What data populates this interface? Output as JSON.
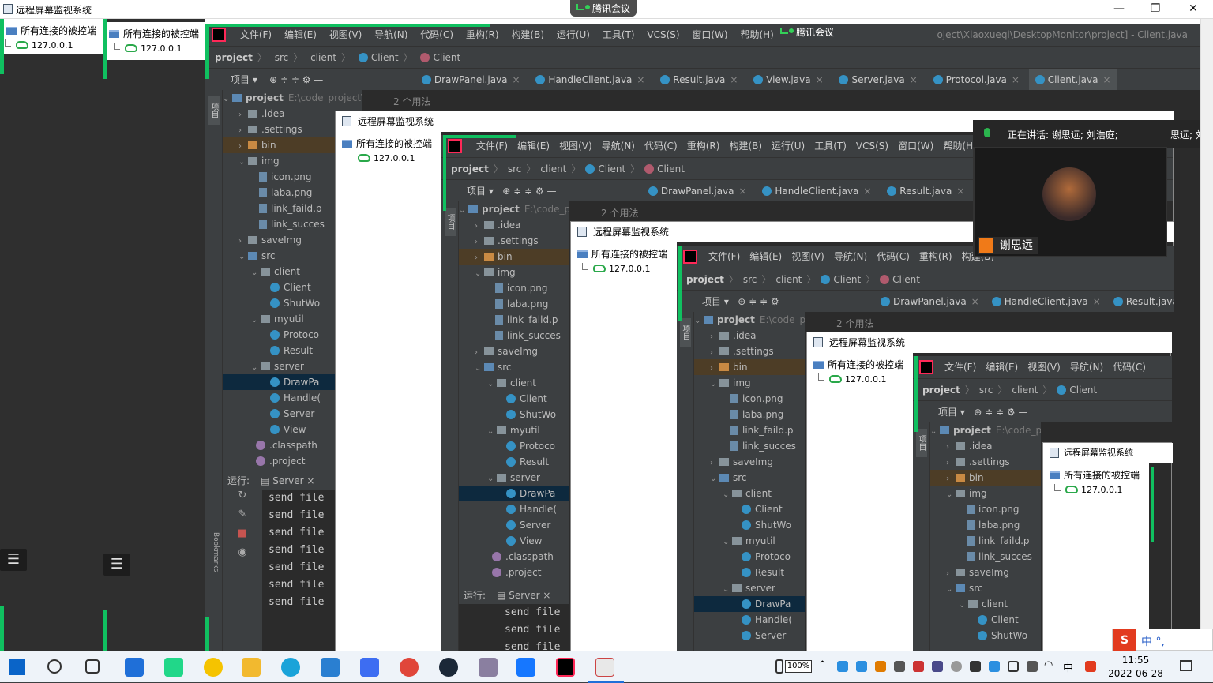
{
  "window": {
    "title": "远程屏幕监视系统",
    "minimize_label": "—",
    "maximize_label": "❐",
    "close_label": "✕"
  },
  "meeting": {
    "pill_label": "腾讯会议",
    "speaking_text": "正在讲话: 谢思远; 刘浩庭;",
    "speaking_trunc": "思远; 刘",
    "participant_name": "谢思远"
  },
  "tree": {
    "root_label": "所有连接的被控端",
    "child_label": "127.0.0.1"
  },
  "ide": {
    "menu": [
      "文件(F)",
      "编辑(E)",
      "视图(V)",
      "导航(N)",
      "代码(C)",
      "重构(R)",
      "构建(B)",
      "运行(U)",
      "工具(T)",
      "VCS(S)",
      "窗口(W)",
      "帮助(H)"
    ],
    "title_path": "projec",
    "title_path_tail": "oject\\Xiaoxueqi\\DesktopMonitor\\project] - Client.java",
    "nav": {
      "project": "project",
      "src": "src",
      "client": "client",
      "class1": "Client",
      "class2": "Client"
    },
    "project_tab": "项目",
    "side_label": "项目",
    "tabs": [
      "DrawPanel.java",
      "HandleClient.java",
      "Result.java",
      "View.java",
      "Server.java",
      "Protocol.java",
      "Client.java"
    ],
    "usage_text": "2 个用法",
    "project_root": "project",
    "project_path": "E:\\code_project\\Xiaoxueqi",
    "files": {
      "idea": ".idea",
      "settings": ".settings",
      "bin": "bin",
      "img": "img",
      "icon": "icon.png",
      "laba": "laba.png",
      "link_faild": "link_faild.p",
      "link_succes": "link_succes",
      "saveImg": "saveImg",
      "src": "src",
      "client": "client",
      "Client": "Client",
      "ShutWo": "ShutWo",
      "myutil": "myutil",
      "Protoco": "Protoco",
      "Result": "Result",
      "server": "server",
      "DrawPa": "DrawPa",
      "Handle": "Handle(",
      "Server": "Server",
      "View": "View",
      "classpath": ".classpath",
      "projfile": ".project"
    },
    "run_label": "运行:",
    "run_config": "Server",
    "console_lines": [
      "send file",
      "send file",
      "send file",
      "send file",
      "send file",
      "send file",
      "send file"
    ],
    "bookmarks_label": "Bookmarks"
  },
  "taskbar": {
    "time": "11:55",
    "date": "2022-06-28",
    "battery": "100%",
    "ime_text": "中 °,"
  },
  "colors": {
    "accent_green": "#10c060",
    "ide_bg": "#2b2b2b",
    "ide_panel": "#3c3f41",
    "selection": "#0d293e"
  }
}
